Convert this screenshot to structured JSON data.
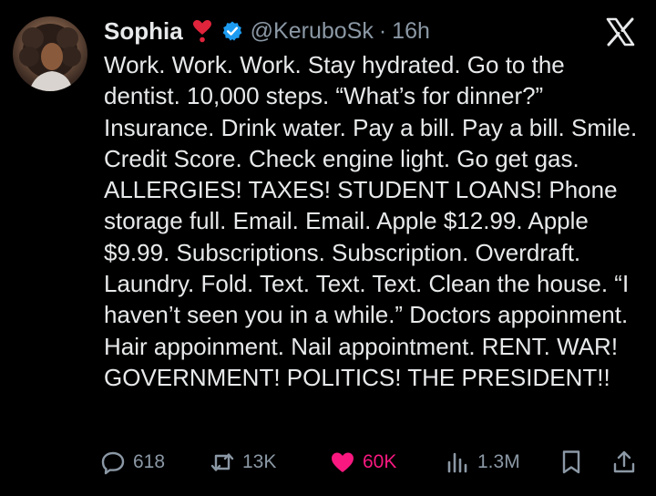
{
  "author": {
    "name": "Sophia",
    "emoji": "heart-exclamation",
    "verified": true,
    "handle": "@KeruboSk",
    "separator": "·",
    "time": "16h"
  },
  "tweet": {
    "text": "Work. Work. Work. Stay hydrated. Go to the dentist. 10,000 steps. “What’s for dinner?” Insurance. Drink water. Pay a bill. Pay a bill. Smile. Credit Score. Check engine light. Go get gas. ALLERGIES! TAXES! STUDENT LOANS! Phone storage full. Email. Email. Apple $12.99. Apple $9.99. Subscriptions. Subscription. Overdraft. Laundry. Fold. Text. Text. Text. Clean the house. “I haven’t seen you in a while.” Doctors appoinment.  Hair appoinment.  Nail appointment.  RENT. WAR! GOVERNMENT! POLITICS! THE PRESIDENT!!"
  },
  "actions": {
    "replies": "618",
    "reposts": "13K",
    "likes": "60K",
    "views": "1.3M"
  },
  "colors": {
    "background": "#000000",
    "text": "#e7e9ea",
    "muted": "#8b98a5",
    "verified": "#1d9bf0",
    "like": "#f91880",
    "emoji_heart": "#e0243b"
  },
  "icons": {
    "platform": "x-logo-icon",
    "reply": "reply-icon",
    "repost": "repost-icon",
    "like": "heart-icon",
    "views": "views-icon",
    "bookmark": "bookmark-icon",
    "share": "share-icon"
  }
}
